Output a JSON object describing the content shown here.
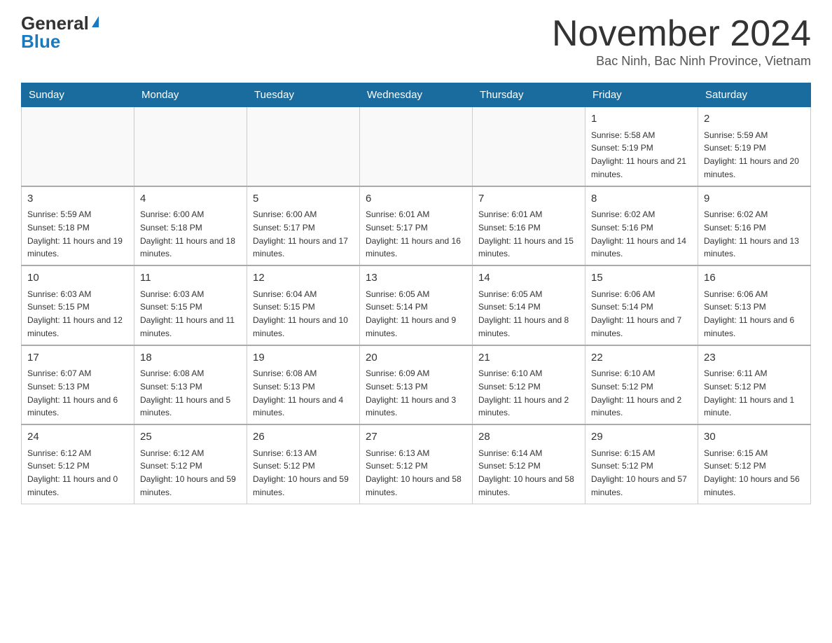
{
  "header": {
    "logo_general": "General",
    "logo_blue": "Blue",
    "month_title": "November 2024",
    "location": "Bac Ninh, Bac Ninh Province, Vietnam"
  },
  "days_of_week": [
    "Sunday",
    "Monday",
    "Tuesday",
    "Wednesday",
    "Thursday",
    "Friday",
    "Saturday"
  ],
  "weeks": [
    [
      {
        "day": "",
        "info": ""
      },
      {
        "day": "",
        "info": ""
      },
      {
        "day": "",
        "info": ""
      },
      {
        "day": "",
        "info": ""
      },
      {
        "day": "",
        "info": ""
      },
      {
        "day": "1",
        "info": "Sunrise: 5:58 AM\nSunset: 5:19 PM\nDaylight: 11 hours and 21 minutes."
      },
      {
        "day": "2",
        "info": "Sunrise: 5:59 AM\nSunset: 5:19 PM\nDaylight: 11 hours and 20 minutes."
      }
    ],
    [
      {
        "day": "3",
        "info": "Sunrise: 5:59 AM\nSunset: 5:18 PM\nDaylight: 11 hours and 19 minutes."
      },
      {
        "day": "4",
        "info": "Sunrise: 6:00 AM\nSunset: 5:18 PM\nDaylight: 11 hours and 18 minutes."
      },
      {
        "day": "5",
        "info": "Sunrise: 6:00 AM\nSunset: 5:17 PM\nDaylight: 11 hours and 17 minutes."
      },
      {
        "day": "6",
        "info": "Sunrise: 6:01 AM\nSunset: 5:17 PM\nDaylight: 11 hours and 16 minutes."
      },
      {
        "day": "7",
        "info": "Sunrise: 6:01 AM\nSunset: 5:16 PM\nDaylight: 11 hours and 15 minutes."
      },
      {
        "day": "8",
        "info": "Sunrise: 6:02 AM\nSunset: 5:16 PM\nDaylight: 11 hours and 14 minutes."
      },
      {
        "day": "9",
        "info": "Sunrise: 6:02 AM\nSunset: 5:16 PM\nDaylight: 11 hours and 13 minutes."
      }
    ],
    [
      {
        "day": "10",
        "info": "Sunrise: 6:03 AM\nSunset: 5:15 PM\nDaylight: 11 hours and 12 minutes."
      },
      {
        "day": "11",
        "info": "Sunrise: 6:03 AM\nSunset: 5:15 PM\nDaylight: 11 hours and 11 minutes."
      },
      {
        "day": "12",
        "info": "Sunrise: 6:04 AM\nSunset: 5:15 PM\nDaylight: 11 hours and 10 minutes."
      },
      {
        "day": "13",
        "info": "Sunrise: 6:05 AM\nSunset: 5:14 PM\nDaylight: 11 hours and 9 minutes."
      },
      {
        "day": "14",
        "info": "Sunrise: 6:05 AM\nSunset: 5:14 PM\nDaylight: 11 hours and 8 minutes."
      },
      {
        "day": "15",
        "info": "Sunrise: 6:06 AM\nSunset: 5:14 PM\nDaylight: 11 hours and 7 minutes."
      },
      {
        "day": "16",
        "info": "Sunrise: 6:06 AM\nSunset: 5:13 PM\nDaylight: 11 hours and 6 minutes."
      }
    ],
    [
      {
        "day": "17",
        "info": "Sunrise: 6:07 AM\nSunset: 5:13 PM\nDaylight: 11 hours and 6 minutes."
      },
      {
        "day": "18",
        "info": "Sunrise: 6:08 AM\nSunset: 5:13 PM\nDaylight: 11 hours and 5 minutes."
      },
      {
        "day": "19",
        "info": "Sunrise: 6:08 AM\nSunset: 5:13 PM\nDaylight: 11 hours and 4 minutes."
      },
      {
        "day": "20",
        "info": "Sunrise: 6:09 AM\nSunset: 5:13 PM\nDaylight: 11 hours and 3 minutes."
      },
      {
        "day": "21",
        "info": "Sunrise: 6:10 AM\nSunset: 5:12 PM\nDaylight: 11 hours and 2 minutes."
      },
      {
        "day": "22",
        "info": "Sunrise: 6:10 AM\nSunset: 5:12 PM\nDaylight: 11 hours and 2 minutes."
      },
      {
        "day": "23",
        "info": "Sunrise: 6:11 AM\nSunset: 5:12 PM\nDaylight: 11 hours and 1 minute."
      }
    ],
    [
      {
        "day": "24",
        "info": "Sunrise: 6:12 AM\nSunset: 5:12 PM\nDaylight: 11 hours and 0 minutes."
      },
      {
        "day": "25",
        "info": "Sunrise: 6:12 AM\nSunset: 5:12 PM\nDaylight: 10 hours and 59 minutes."
      },
      {
        "day": "26",
        "info": "Sunrise: 6:13 AM\nSunset: 5:12 PM\nDaylight: 10 hours and 59 minutes."
      },
      {
        "day": "27",
        "info": "Sunrise: 6:13 AM\nSunset: 5:12 PM\nDaylight: 10 hours and 58 minutes."
      },
      {
        "day": "28",
        "info": "Sunrise: 6:14 AM\nSunset: 5:12 PM\nDaylight: 10 hours and 58 minutes."
      },
      {
        "day": "29",
        "info": "Sunrise: 6:15 AM\nSunset: 5:12 PM\nDaylight: 10 hours and 57 minutes."
      },
      {
        "day": "30",
        "info": "Sunrise: 6:15 AM\nSunset: 5:12 PM\nDaylight: 10 hours and 56 minutes."
      }
    ]
  ]
}
